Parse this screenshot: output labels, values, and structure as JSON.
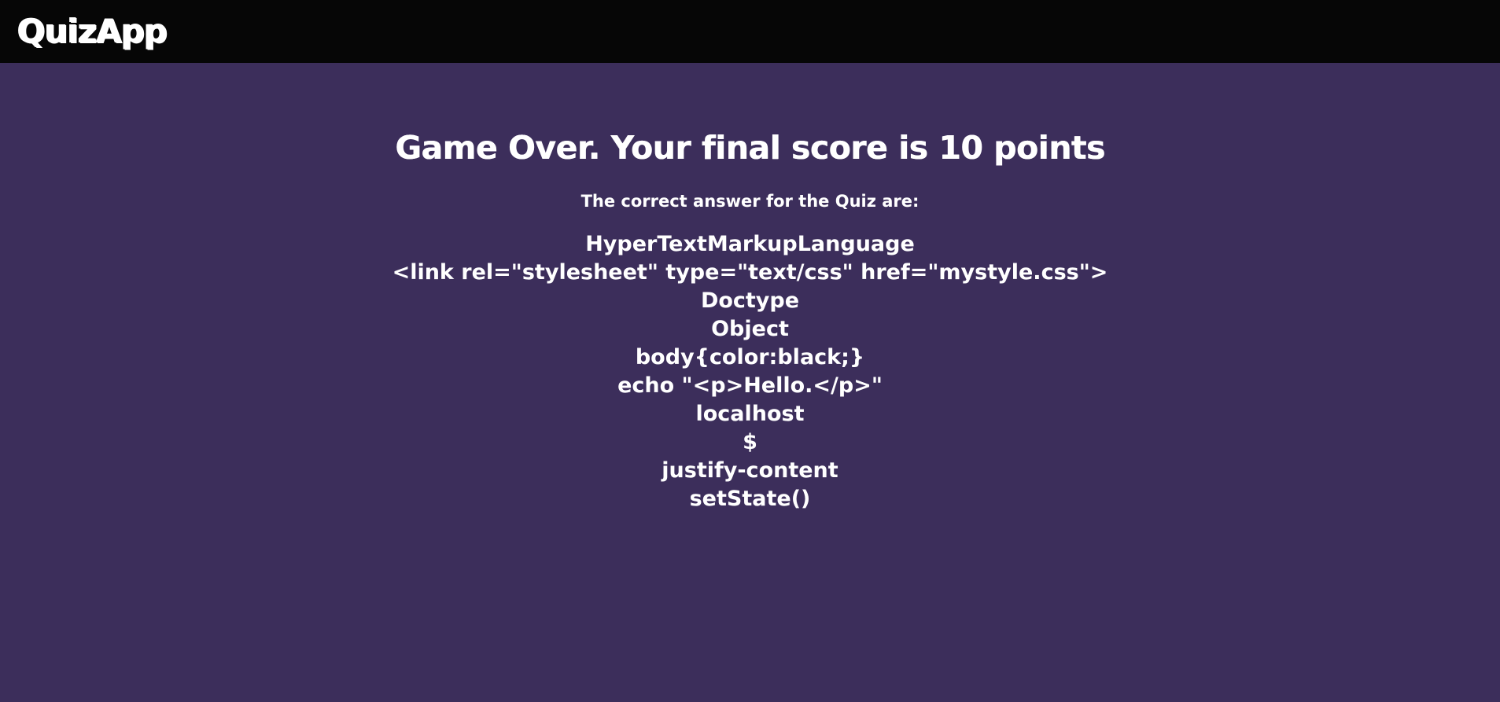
{
  "app": {
    "brand": "QuizApp"
  },
  "result": {
    "headline": "Game Over. Your final score is 10 points",
    "subheading": "The correct answer for the Quiz are:",
    "answers": [
      "HyperTextMarkupLanguage",
      "<link rel=\"stylesheet\" type=\"text/css\" href=\"mystyle.css\">",
      "Doctype",
      "Object",
      "body{color:black;}",
      "echo \"<p>Hello.</p>\"",
      "localhost",
      "$",
      "justify-content",
      "setState()"
    ]
  },
  "colors": {
    "background": "#3c2e5b",
    "topbar": "#060606",
    "text": "#ffffff"
  }
}
